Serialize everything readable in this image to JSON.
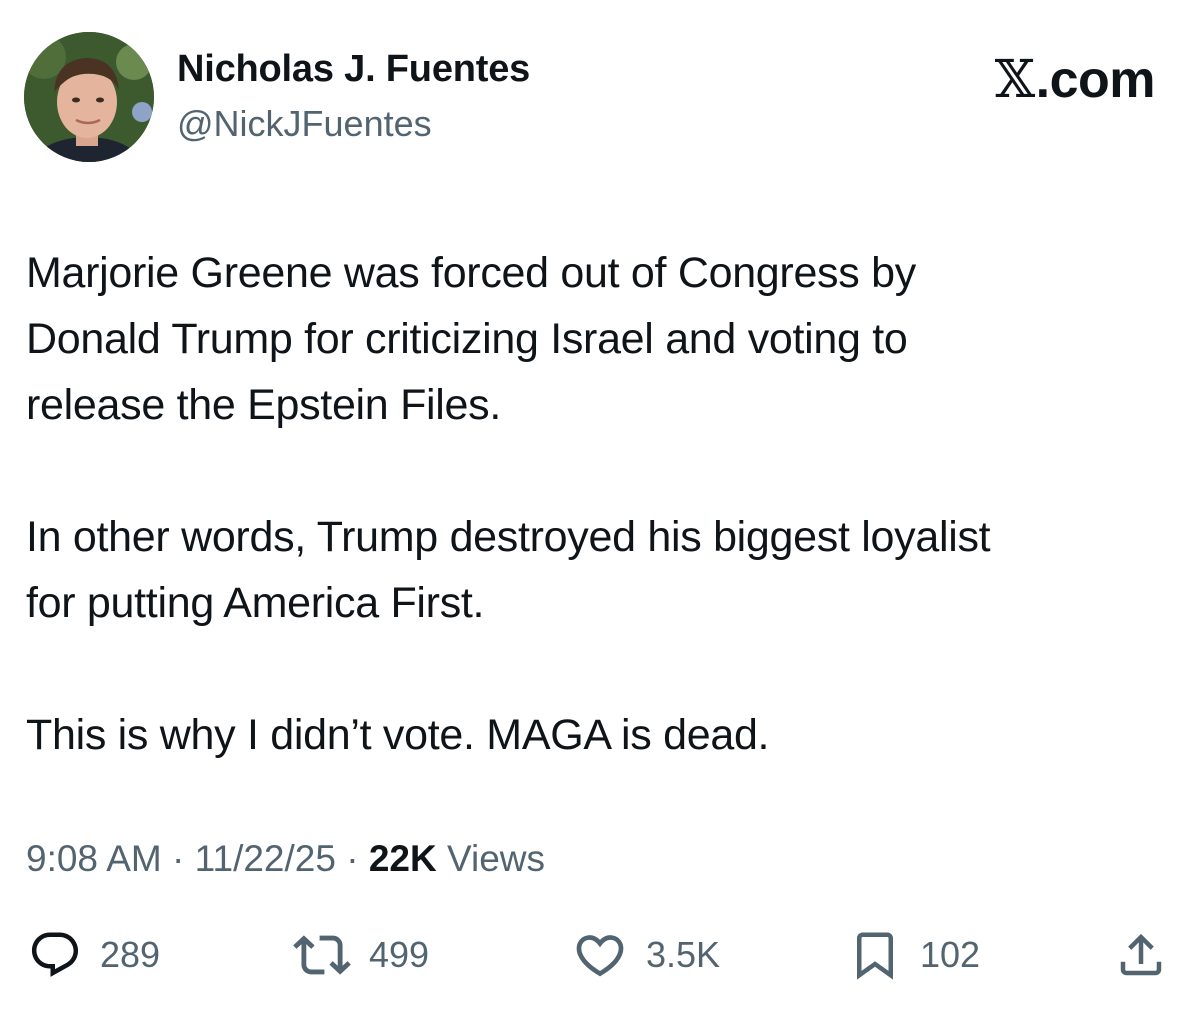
{
  "author": {
    "display_name": "Nicholas J. Fuentes",
    "handle": "@NickJFuentes",
    "avatar_icon": "profile-photo"
  },
  "brand": {
    "x_glyph": "𝕏",
    "domain": ".com"
  },
  "tweet": {
    "paragraphs": [
      "Marjorie Greene was forced out of Congress by\nDonald Trump for criticizing Israel and voting to\nrelease the Epstein Files.",
      "In other words, Trump destroyed his biggest loyalist\nfor putting America First.",
      "This is why I didn’t vote. MAGA is dead."
    ]
  },
  "meta": {
    "time": "9:08 AM",
    "separator": " · ",
    "date": "11/22/25",
    "views_count": "22K",
    "views_label": " Views"
  },
  "actions": {
    "reply": {
      "icon": "reply-icon",
      "count": "289"
    },
    "retweet": {
      "icon": "retweet-icon",
      "count": "499"
    },
    "like": {
      "icon": "heart-icon",
      "count": "3.5K"
    },
    "bookmark": {
      "icon": "bookmark-icon",
      "count": "102"
    },
    "share": {
      "icon": "share-icon"
    }
  },
  "colors": {
    "text_primary": "#0f1419",
    "text_secondary": "#536471"
  }
}
